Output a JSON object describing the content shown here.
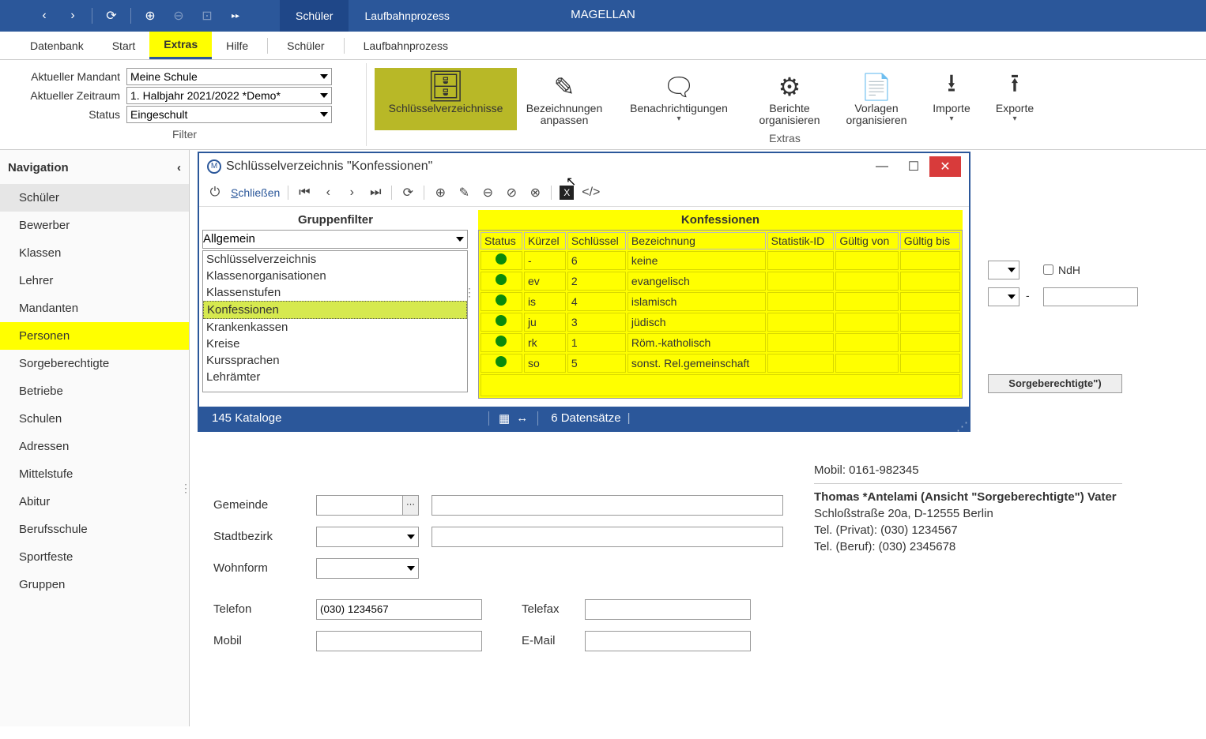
{
  "titlebar": {
    "app_title": "MAGELLAN",
    "tabs": [
      "Schüler",
      "Laufbahnprozess"
    ]
  },
  "menubar": {
    "items": [
      "Datenbank",
      "Start",
      "Extras",
      "Hilfe",
      "Schüler",
      "Laufbahnprozess"
    ],
    "active": "Extras"
  },
  "filters": {
    "mandant_label": "Aktueller Mandant",
    "mandant_value": "Meine Schule",
    "zeitraum_label": "Aktueller Zeitraum",
    "zeitraum_value": "1. Halbjahr 2021/2022 *Demo*",
    "status_label": "Status",
    "status_value": "Eingeschult",
    "section_label": "Filter"
  },
  "ribbon": {
    "buttons": [
      {
        "label": "Schlüsselverzeichnisse",
        "icon": "≡"
      },
      {
        "label": "Bezeichnungen anpassen",
        "icon": "✎"
      },
      {
        "label": "Benachrichtigungen",
        "icon": "💬",
        "drop": true
      },
      {
        "label": "Berichte organisieren",
        "icon": "⚙"
      },
      {
        "label": "Vorlagen organisieren",
        "icon": "📄"
      },
      {
        "label": "Importe",
        "icon": "↪",
        "drop": true
      },
      {
        "label": "Exporte",
        "icon": "↩",
        "drop": true
      }
    ],
    "section_label": "Extras"
  },
  "nav": {
    "title": "Navigation",
    "items": [
      "Schüler",
      "Bewerber",
      "Klassen",
      "Lehrer",
      "Mandanten",
      "Personen",
      "Sorgeberechtigte",
      "Betriebe",
      "Schulen",
      "Adressen",
      "Mittelstufe",
      "Abitur",
      "Berufsschule",
      "Sportfeste",
      "Gruppen"
    ],
    "active": "Schüler"
  },
  "form": {
    "ndh_label": "NdH",
    "gemeinde": "Gemeinde",
    "stadtbezirk": "Stadtbezirk",
    "wohnform": "Wohnform",
    "telefon": "Telefon",
    "telefon_val": "(030) 1234567",
    "telefax": "Telefax",
    "mobil": "Mobil",
    "email": "E-Mail",
    "sb_box": "Sorgeberechtigte\")"
  },
  "info": {
    "line1": "Mobil: 0161-982345",
    "head": "Thomas *Antelami (Ansicht \"Sorgeberechtigte\") Vater",
    "addr": "Schloßstraße 20a, D-12555 Berlin",
    "tel1": "Tel. (Privat): (030) 1234567",
    "tel2": "Tel. (Beruf): (030) 2345678"
  },
  "modal": {
    "title": "Schlüsselverzeichnis \"Konfessionen\"",
    "close_label": "Schließen",
    "group_title": "Gruppenfilter",
    "group_value": "Allgemein",
    "list_items": [
      "Schlüsselverzeichnis",
      "Klassenorganisationen",
      "Klassenstufen",
      "Konfessionen",
      "Krankenkassen",
      "Kreise",
      "Kurssprachen",
      "Lehrämter"
    ],
    "list_selected": "Konfessionen",
    "right_title": "Konfessionen",
    "columns": [
      "Status",
      "Kürzel",
      "Schlüssel",
      "Bezeichnung",
      "Statistik-ID",
      "Gültig von",
      "Gültig bis"
    ],
    "rows": [
      {
        "kuerzel": "-",
        "schluessel": "6",
        "bez": "keine"
      },
      {
        "kuerzel": "ev",
        "schluessel": "2",
        "bez": "evangelisch"
      },
      {
        "kuerzel": "is",
        "schluessel": "4",
        "bez": "islamisch"
      },
      {
        "kuerzel": "ju",
        "schluessel": "3",
        "bez": "jüdisch"
      },
      {
        "kuerzel": "rk",
        "schluessel": "1",
        "bez": "Röm.-katholisch"
      },
      {
        "kuerzel": "so",
        "schluessel": "5",
        "bez": "sonst. Rel.gemeinschaft"
      }
    ],
    "status_left": "145 Kataloge",
    "status_right": "6 Datensätze"
  }
}
